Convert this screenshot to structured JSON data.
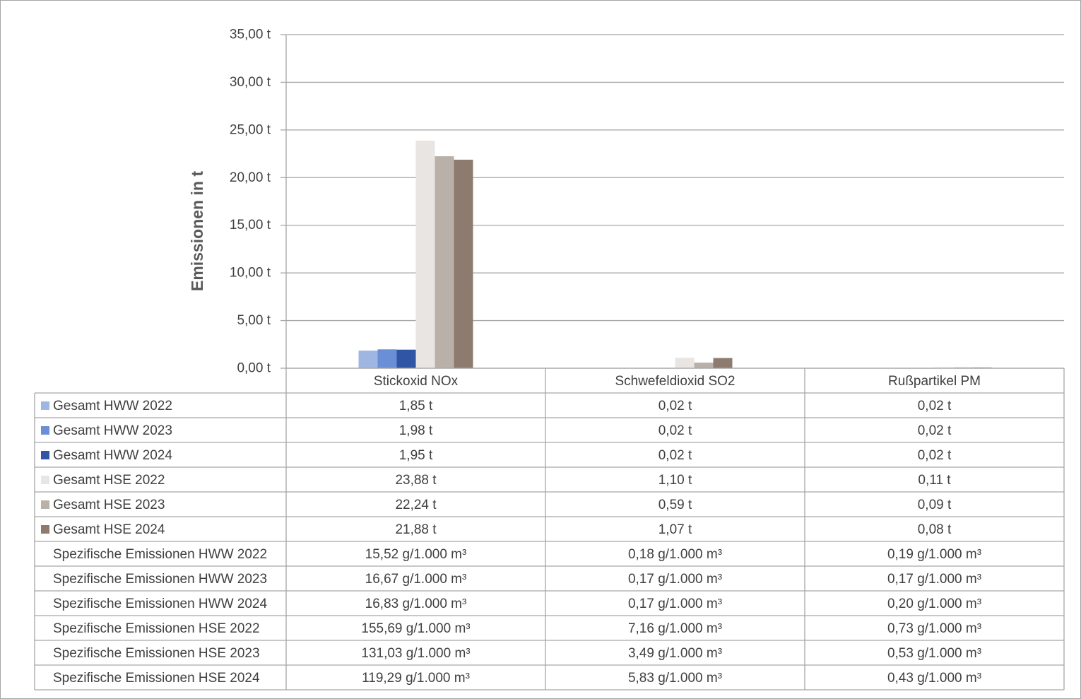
{
  "chart_data": {
    "type": "bar",
    "ylabel": "Emissionen in t",
    "ylim": [
      0,
      35
    ],
    "y_ticks": [
      0,
      5,
      10,
      15,
      20,
      25,
      30,
      35
    ],
    "y_tick_labels": [
      "0,00 t",
      "5,00 t",
      "10,00 t",
      "15,00 t",
      "20,00 t",
      "25,00 t",
      "30,00 t",
      "35,00 t"
    ],
    "grid": true,
    "legend": "data-table",
    "categories": [
      "Stickoxid NOx",
      "Schwefeldioxid SO2",
      "Rußpartikel PM"
    ],
    "series": [
      {
        "name": "Gesamt HWW 2022",
        "color": "#9fb6e2",
        "values": [
          1.85,
          0.02,
          0.02
        ],
        "labels": [
          "1,85 t",
          "0,02 t",
          "0,02 t"
        ]
      },
      {
        "name": "Gesamt HWW 2023",
        "color": "#6a8fd6",
        "values": [
          1.98,
          0.02,
          0.02
        ],
        "labels": [
          "1,98 t",
          "0,02 t",
          "0,02 t"
        ]
      },
      {
        "name": "Gesamt HWW 2024",
        "color": "#2f55a4",
        "values": [
          1.95,
          0.02,
          0.02
        ],
        "labels": [
          "1,95 t",
          "0,02 t",
          "0,02 t"
        ]
      },
      {
        "name": "Gesamt HSE 2022",
        "color": "#e8e5e2",
        "values": [
          23.88,
          1.1,
          0.11
        ],
        "labels": [
          "23,88 t",
          "1,10 t",
          "0,11 t"
        ]
      },
      {
        "name": "Gesamt HSE 2023",
        "color": "#b9b1a9",
        "values": [
          22.24,
          0.59,
          0.09
        ],
        "labels": [
          "22,24 t",
          "0,59 t",
          "0,09 t"
        ]
      },
      {
        "name": "Gesamt HSE 2024",
        "color": "#8c7b6e",
        "values": [
          21.88,
          1.07,
          0.08
        ],
        "labels": [
          "21,88 t",
          "1,07 t",
          "0,08 t"
        ]
      }
    ],
    "table_only_rows": [
      {
        "name": "Spezifische Emissionen HWW 2022",
        "labels": [
          "15,52 g/1.000 m³",
          "0,18 g/1.000 m³",
          "0,19 g/1.000 m³"
        ]
      },
      {
        "name": "Spezifische Emissionen HWW 2023",
        "labels": [
          "16,67 g/1.000 m³",
          "0,17 g/1.000 m³",
          "0,17 g/1.000 m³"
        ]
      },
      {
        "name": "Spezifische Emissionen HWW 2024",
        "labels": [
          "16,83 g/1.000 m³",
          "0,17 g/1.000 m³",
          "0,20 g/1.000 m³"
        ]
      },
      {
        "name": "Spezifische Emissionen HSE 2022",
        "labels": [
          "155,69 g/1.000 m³",
          "7,16 g/1.000 m³",
          "0,73 g/1.000 m³"
        ]
      },
      {
        "name": "Spezifische Emissionen HSE 2023",
        "labels": [
          "131,03 g/1.000 m³",
          "3,49 g/1.000 m³",
          "0,53 g/1.000 m³"
        ]
      },
      {
        "name": "Spezifische Emissionen HSE 2024",
        "labels": [
          "119,29 g/1.000 m³",
          "5,83 g/1.000 m³",
          "0,43 g/1.000 m³"
        ]
      }
    ]
  }
}
